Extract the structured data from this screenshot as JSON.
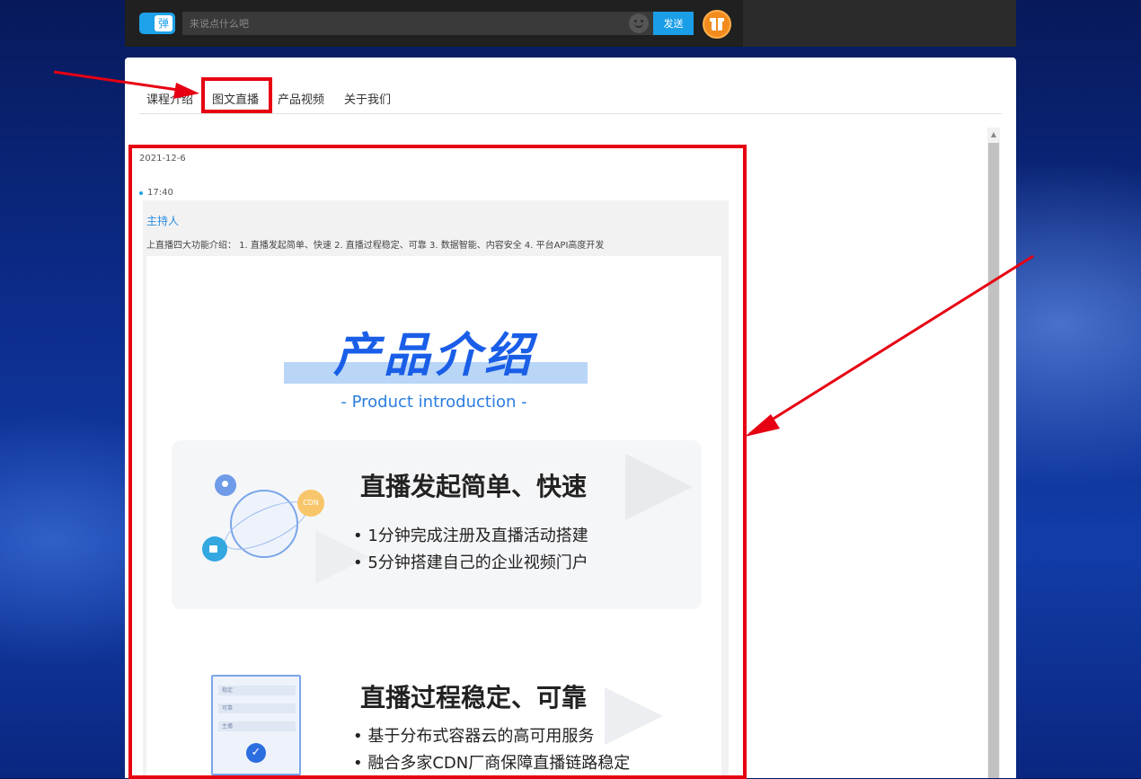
{
  "player_bar": {
    "danmu_button_label": "弹",
    "chat_placeholder": "来说点什么吧",
    "send_label": "发送"
  },
  "tabs": [
    {
      "label": "课程介绍"
    },
    {
      "label": "图文直播"
    },
    {
      "label": "产品视频"
    },
    {
      "label": "关于我们"
    }
  ],
  "feed": {
    "date": "2021-12-6",
    "time": "17:40",
    "author": "主持人",
    "text": "上直播四大功能介绍： 1. 直播发起简单、快速 2. 直播过程稳定、可靠 3. 数据智能、内容安全 4. 平台API高度开发",
    "poster": {
      "title": "产品介绍",
      "subtitle": "- Product introduction -",
      "cdn_badge": "CDN",
      "section1": {
        "title": "直播发起简单、快速",
        "items": [
          "• 1分钟完成注册及直播活动搭建",
          "• 5分钟搭建自己的企业视频门户"
        ]
      },
      "section2": {
        "title": "直播过程稳定、可靠",
        "items": [
          "• 基于分布式容器云的高可用服务",
          "• 融合多家CDN厂商保障直播链路稳定"
        ],
        "form_rows": [
          "稳定",
          "可靠",
          "主播"
        ]
      }
    }
  },
  "colors": {
    "highlight": "#e60012",
    "accent": "#1b9ee8",
    "poster_blue": "#1a5ee8"
  }
}
